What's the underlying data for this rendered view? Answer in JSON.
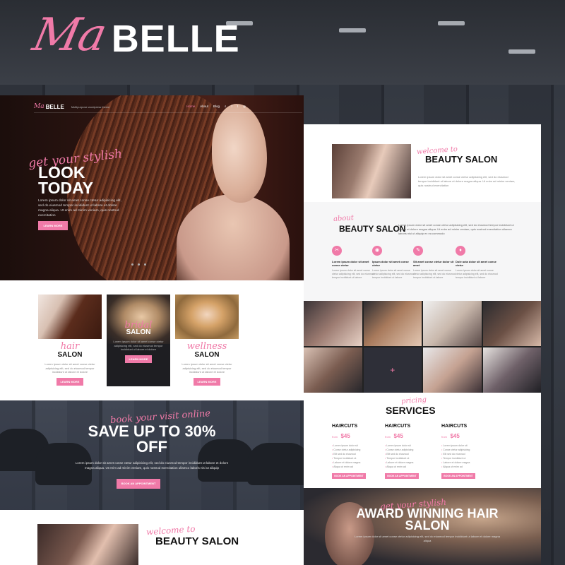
{
  "brand": {
    "script": "Ma",
    "name": "BELLE"
  },
  "colors": {
    "accent": "#f07aa8",
    "dark": "#1e1e22"
  },
  "hero": {
    "nav": {
      "logo_script": "Ma",
      "logo_name": "BELLE",
      "tagline": "Multipurpose wordpress theme",
      "menu": [
        "Home",
        "About",
        "Blog"
      ],
      "icons": [
        "search-icon",
        "facebook-icon",
        "twitter-icon",
        "instagram-icon"
      ]
    },
    "script": "get your stylish",
    "title": "LOOK TODAY",
    "body": "Lorem ipsum dolor sit amet conse ctetur adipisicing elit, sed do eiusmod tempor incididunt ut labore et dolore magna aliqua. Ut enim ad minim veniam, quis nostrud exercitation",
    "button": "LEARN MORE"
  },
  "cards": [
    {
      "script": "hair",
      "title": "SALON",
      "body": "Lorem ipsum dolor sit amet conse ctetur adipisicing elit, sed do eiusmod tempor incididunt ut labore et dolore",
      "button": "LEARN MORE"
    },
    {
      "script": "bridal",
      "title": "SALON",
      "body": "Lorem ipsum dolor sit amet conse ctetur adipisicing elit, sed do eiusmod tempor incididunt ut labore et dolore",
      "button": "LEARN MORE"
    },
    {
      "script": "wellness",
      "title": "SALON",
      "body": "Lorem ipsum dolor sit amet conse ctetur adipisicing elit, sed do eiusmod tempor incididunt ut labore et dolore",
      "button": "LEARN MORE"
    }
  ],
  "promo": {
    "script": "book your visit online",
    "title": "SAVE UP TO 30% OFF",
    "body": "Lorem ipsum dolor sit amet conse ctetur adipisicing elit, sed do eiusmod tempor incididunt ut labore et dolore magna aliqua. Ut enim ad minim veniam, quis nostrud exercitation ullamco laboris nisi ut aliquip",
    "button": "BOOK AN APPOINTMENT"
  },
  "welcome_bottom": {
    "script": "welcome to",
    "title": "BEAUTY SALON"
  },
  "right_welcome": {
    "script": "welcome to",
    "title": "BEAUTY SALON",
    "body": "Lorem ipsum dolor sit amet conse ctetur adipisicing elit, sed do eiusmod tempor incididunt ut labore et dolore magna aliqua. Ut enim ad minim veniam, quis nostrud exercitation"
  },
  "about": {
    "script": "about",
    "title": "BEAUTY SALON",
    "body": "Lorem ipsum dolor sit amet conse ctetur adipisicing elit, sed do eiusmod tempor incididunt ut labore et dolore magna aliqua. Ut enim ad minim veniam, quis nostrud exercitation ullamco laboris nisi ut aliquip ex ea commodo",
    "features": [
      {
        "icon": "scissors-icon",
        "glyph": "✂",
        "title": "Lorem ipsum dolor sit amet conse ctetur",
        "body": "Lorem ipsum dolor sit amet conse ctetur adipisicing elit, sed do eiusmod tempor incididunt ut labore"
      },
      {
        "icon": "eye-icon",
        "glyph": "◉",
        "title": "Ipsum dolor sit amet conse ctetur",
        "body": "Lorem ipsum dolor sit amet conse ctetur adipisicing elit, sed do eiusmod tempor incididunt ut labore"
      },
      {
        "icon": "brush-icon",
        "glyph": "✎",
        "title": "Sit amet conse ctetur dolor sit amet",
        "body": "Lorem ipsum dolor sit amet conse ctetur adipisicing elit, sed do eiusmod tempor incididunt ut labore"
      },
      {
        "icon": "drop-icon",
        "glyph": "♦",
        "title": "Dole acta dolor sit amet conse ctetur",
        "body": "Lorem ipsum dolor sit amet conse ctetur adipisicing elit, sed do eiusmod tempor incididunt ut labore"
      }
    ]
  },
  "services": {
    "script": "pricing",
    "title": "SERVICES",
    "columns": [
      {
        "name": "HAIRCUTS",
        "from": "from",
        "price": "$45",
        "items": [
          "Lorem ipsum dolor sit",
          "Conse ctetur adipisicing",
          "Elit sed do eiusmod",
          "Tempor incididunt ut",
          "Labore et dolore magna",
          "Aliqua ut enim ad"
        ],
        "button": "BOOK AN APPOINTMENT"
      },
      {
        "name": "HAIRCUTS",
        "from": "from",
        "price": "$45",
        "items": [
          "Lorem ipsum dolor sit",
          "Conse ctetur adipisicing",
          "Elit sed do eiusmod",
          "Tempor incididunt ut",
          "Labore et dolore magna",
          "Aliqua ut enim ad"
        ],
        "button": "BOOK AN APPOINTMENT"
      },
      {
        "name": "HAIRCUTS",
        "from": "from",
        "price": "$45",
        "items": [
          "Lorem ipsum dolor sit",
          "Conse ctetur adipisicing",
          "Elit sed do eiusmod",
          "Tempor incididunt ut",
          "Labore et dolore magna",
          "Aliqua ut enim ad"
        ],
        "button": "BOOK AN APPOINTMENT"
      }
    ]
  },
  "award": {
    "script": "get your stylish",
    "title": "AWARD WINNING HAIR SALON",
    "body": "Lorem ipsum dolor sit amet conse ctetur adipisicing elit, sed do eiusmod tempor incididunt ut labore et dolore magna aliqua"
  }
}
